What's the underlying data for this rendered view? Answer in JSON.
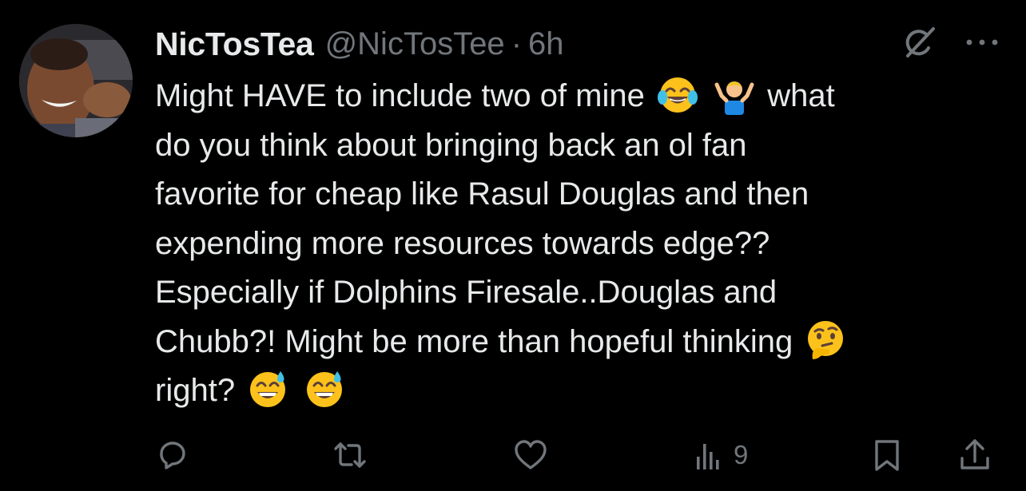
{
  "tweet": {
    "display_name": "NicTosTea",
    "handle": "@NicTosTee",
    "separator": "·",
    "time": "6h",
    "text_lines": [
      {
        "segments": [
          "Might HAVE to include two of mine",
          "",
          "what"
        ]
      },
      {
        "segments": [
          "do you think about bringing back an ol fan"
        ]
      },
      {
        "segments": [
          "favorite for cheap like Rasul Douglas and then"
        ]
      },
      {
        "segments": [
          "expending more resources towards edge??"
        ]
      },
      {
        "segments": [
          "Especially if Dolphins Firesale..Douglas and"
        ]
      },
      {
        "segments": [
          "Chubb?! Might be more than hopeful thinking"
        ]
      },
      {
        "segments": [
          "right?"
        ]
      }
    ]
  },
  "icons": {
    "grok": "grok-icon",
    "more": "more-icon",
    "reply": "reply-icon",
    "retweet": "retweet-icon",
    "like": "like-icon",
    "views": "views-icon",
    "bookmark": "bookmark-icon",
    "share": "share-icon"
  },
  "emojis": {
    "line1": [
      "face-with-tears-of-joy-emoji",
      "man-shrugging-emoji"
    ],
    "line6": [
      "thinking-face-emoji"
    ],
    "line7": [
      "grinning-face-with-sweat-emoji",
      "grinning-face-with-sweat-emoji"
    ]
  },
  "actions": {
    "views_count": "9"
  },
  "colors": {
    "background": "#000000",
    "text_primary": "#e7e9ea",
    "text_secondary": "#71767b"
  }
}
